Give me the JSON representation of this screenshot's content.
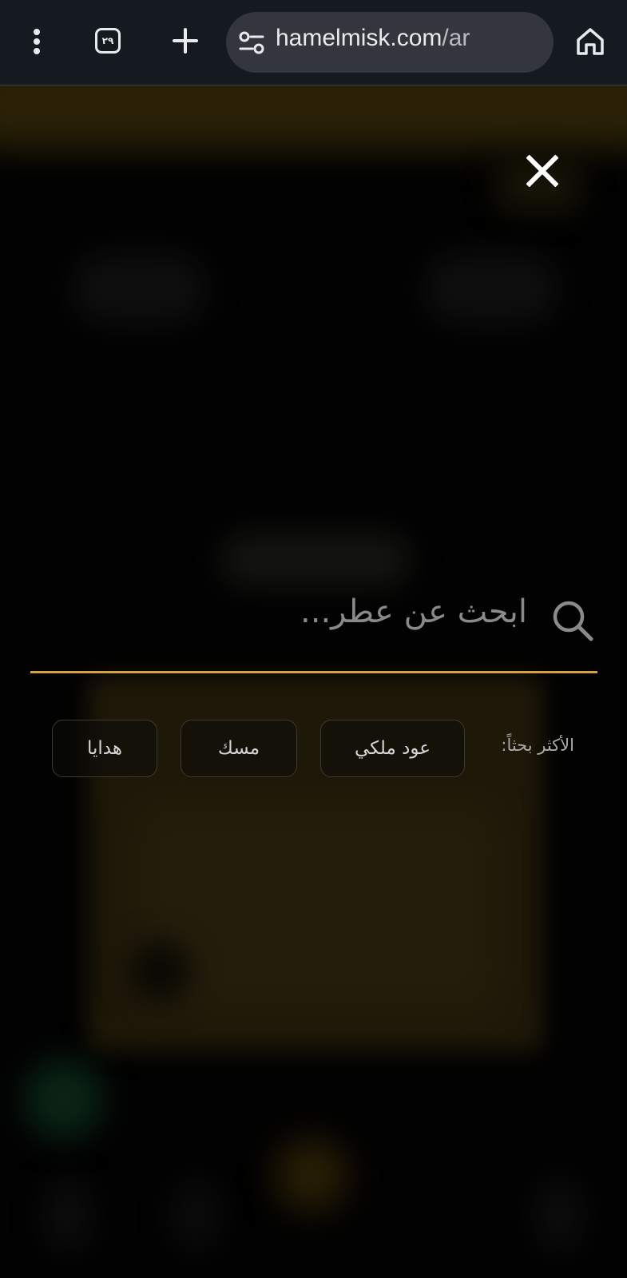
{
  "browser": {
    "tab_count": "٢٩",
    "url_domain": "hamelmisk.com",
    "url_path": "/ar"
  },
  "search": {
    "placeholder": "ابحث عن عطر...",
    "value": ""
  },
  "popular": {
    "label": "الأكثر بحثاً:",
    "chips": [
      {
        "label": "عود ملكي"
      },
      {
        "label": "مسك"
      },
      {
        "label": "هدايا"
      }
    ]
  },
  "colors": {
    "accent": "#d6a23f",
    "browser_bar": "#151a21",
    "address_bar": "#33373d",
    "overlay_background": "#020202"
  },
  "icons": {
    "menu": "vertical-dots-icon",
    "tabs": "tab-switcher-icon",
    "new_tab": "plus-icon",
    "site_settings": "tune-icon",
    "home": "home-icon",
    "close": "close-icon",
    "search": "search-icon"
  }
}
